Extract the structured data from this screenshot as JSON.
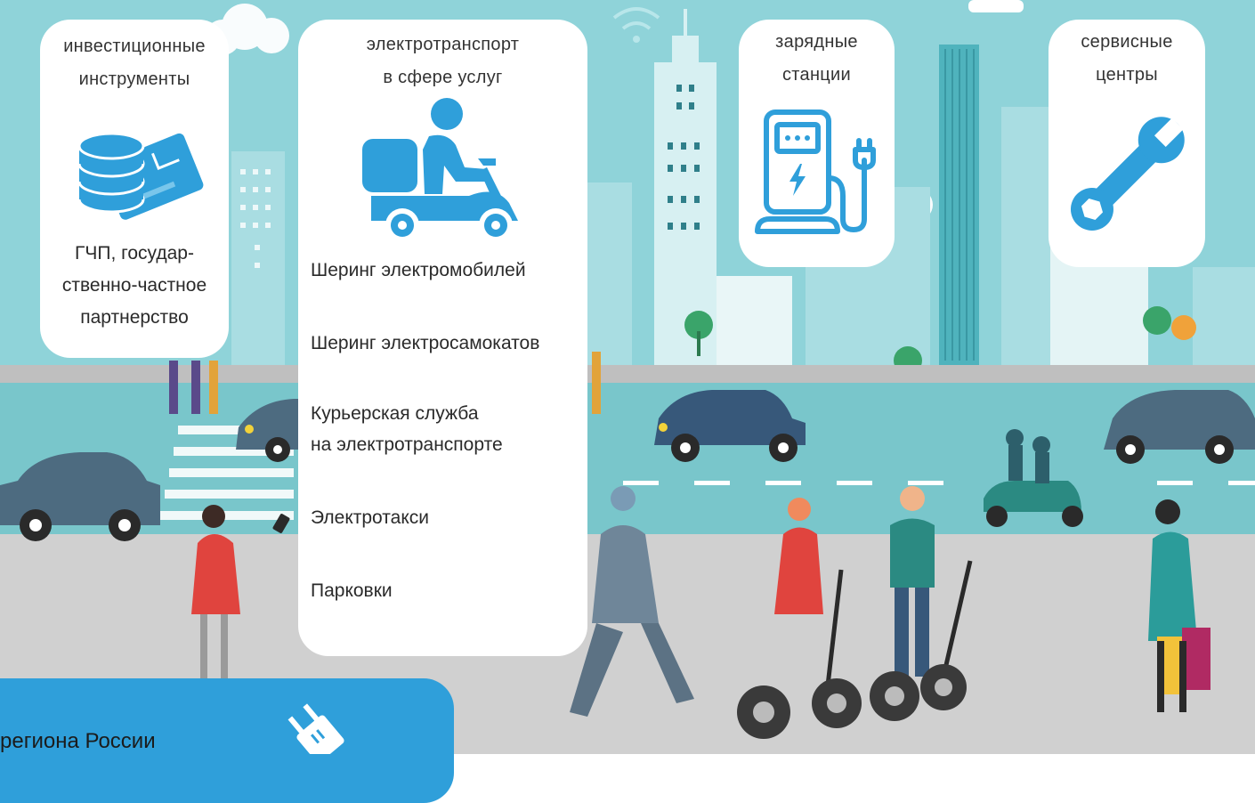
{
  "cards": {
    "investment": {
      "title_line1": "инвестиционные",
      "title_line2": "инструменты",
      "text_line1": "ГЧП, государ-",
      "text_line2": "ственно-частное",
      "text_line3": "партнерство",
      "icon": "coins-card-icon"
    },
    "services": {
      "title_line1": "электротранспорт",
      "title_line2": "в сфере услуг",
      "icon": "delivery-scooter-icon",
      "items": [
        {
          "line1": "Шеринг электромобилей",
          "line2": ""
        },
        {
          "line1": "Шеринг электросамокатов",
          "line2": ""
        },
        {
          "line1": "Курьерская служба",
          "line2": "на электротранспорте"
        },
        {
          "line1": "Электротакси",
          "line2": ""
        },
        {
          "line1": "Парковки",
          "line2": ""
        }
      ]
    },
    "charging": {
      "title_line1": "зарядные",
      "title_line2": "станции",
      "icon": "charging-station-icon"
    },
    "service_centers": {
      "title_line1": "сервисные",
      "title_line2": "центры",
      "icon": "wrench-icon"
    }
  },
  "bottom": {
    "text": "о региона России",
    "icon": "plug-icon"
  },
  "colors": {
    "accent": "#2f9fda",
    "sky": "#8fd3d9",
    "road": "#c9c9c9",
    "lane": "#79c6cb"
  }
}
